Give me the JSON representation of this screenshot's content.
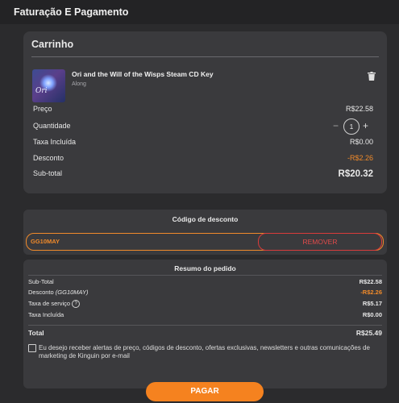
{
  "header": {
    "title": "Faturação E Pagamento"
  },
  "cart": {
    "title": "Carrinho",
    "product": {
      "name": "Ori and the Will of the Wisps Steam CD Key",
      "seller": "Along",
      "thumb_text": "Ori"
    },
    "price_label": "Preço",
    "price": "R$22.58",
    "qty_label": "Quantidade",
    "qty_minus": "−",
    "qty": "1",
    "qty_plus": "+",
    "tax_label": "Taxa Incluída",
    "tax": "R$0.00",
    "discount_label": "Desconto",
    "discount": "-R$2.26",
    "subtotal_label": "Sub-total",
    "subtotal": "R$20.32"
  },
  "coupon": {
    "title": "Código de desconto",
    "code": "GG10MAY",
    "remove_label": "REMOVER"
  },
  "summary": {
    "title": "Resumo do pedido",
    "subtotal_label": "Sub-Total",
    "subtotal": "R$22.58",
    "discount_label": "Desconto",
    "discount_code": "(GG10MAY)",
    "discount": "-R$2.26",
    "service_label": "Taxa de serviço",
    "service_info": "?",
    "service": "R$5.17",
    "tax_label": "Taxa Incluída",
    "tax": "R$0.00",
    "total_label": "Total",
    "total": "R$25.49",
    "consent": "Eu desejo receber alertas de preço, códigos de desconto, ofertas exclusivas, newsletters e outras comunicações de marketing de Kinguin por e-mail"
  },
  "pay_label": "PAGAR",
  "colors": {
    "accent": "#f5821f",
    "danger": "#e24b4b",
    "card": "#3a3a3d",
    "background": "#2b2b2d"
  }
}
